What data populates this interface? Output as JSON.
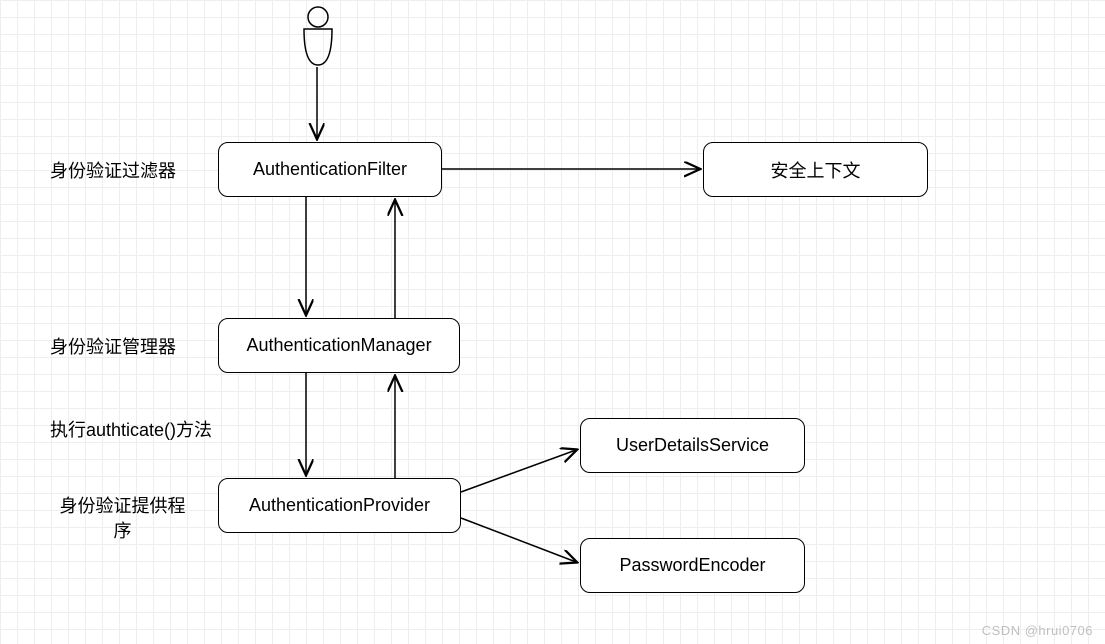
{
  "actor": {
    "name": "user-actor"
  },
  "labels": {
    "filter": "身份验证过滤器",
    "manager": "身份验证管理器",
    "method": "执行authticate()方法",
    "provider_line1": "身份验证提供程",
    "provider_line2": "序"
  },
  "nodes": {
    "auth_filter": "AuthenticationFilter",
    "security_context": "安全上下文",
    "auth_manager": "AuthenticationManager",
    "auth_provider": "AuthenticationProvider",
    "user_details_service": "UserDetailsService",
    "password_encoder": "PasswordEncoder"
  },
  "watermark": "CSDN @hrui0706"
}
